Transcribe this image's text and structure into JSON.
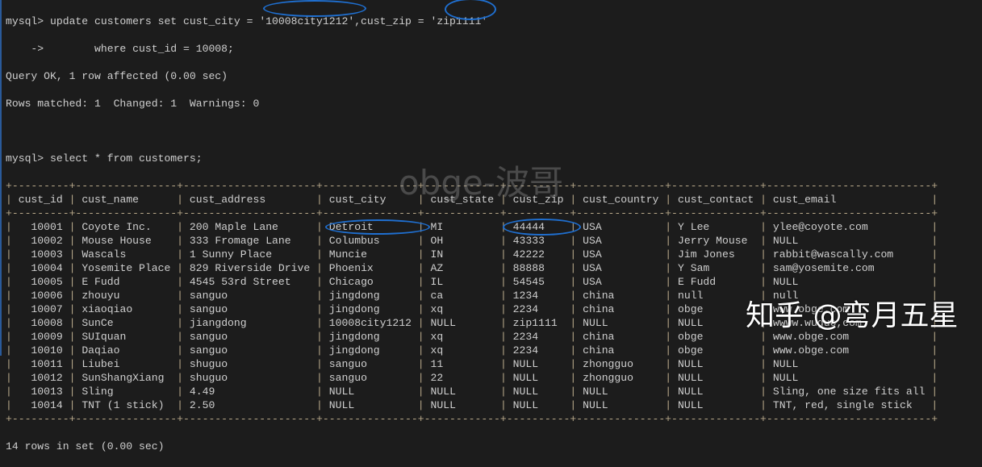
{
  "command": {
    "line1_prefix": "mysql> update customers set cust_city = ",
    "city_value": "'10008city1212'",
    "mid": ",cust_zip = ",
    "zip_value": "'zip1111'",
    "line2": "    ->        where cust_id = 10008;",
    "result1": "Query OK, 1 row affected (0.00 sec)",
    "result2": "Rows matched: 1  Changed: 1  Warnings: 0",
    "select": "mysql> select * from customers;"
  },
  "table": {
    "columns": [
      "cust_id",
      "cust_name",
      "cust_address",
      "cust_city",
      "cust_state",
      "cust_zip",
      "cust_country",
      "cust_contact",
      "cust_email"
    ],
    "rows": [
      [
        "10001",
        "Coyote Inc.",
        "200 Maple Lane",
        "Detroit",
        "MI",
        "44444",
        "USA",
        "Y Lee",
        "ylee@coyote.com"
      ],
      [
        "10002",
        "Mouse House",
        "333 Fromage Lane",
        "Columbus",
        "OH",
        "43333",
        "USA",
        "Jerry Mouse",
        "NULL"
      ],
      [
        "10003",
        "Wascals",
        "1 Sunny Place",
        "Muncie",
        "IN",
        "42222",
        "USA",
        "Jim Jones",
        "rabbit@wascally.com"
      ],
      [
        "10004",
        "Yosemite Place",
        "829 Riverside Drive",
        "Phoenix",
        "AZ",
        "88888",
        "USA",
        "Y Sam",
        "sam@yosemite.com"
      ],
      [
        "10005",
        "E Fudd",
        "4545 53rd Street",
        "Chicago",
        "IL",
        "54545",
        "USA",
        "E Fudd",
        "NULL"
      ],
      [
        "10006",
        "zhouyu",
        "sanguo",
        "jingdong",
        "ca",
        "1234",
        "china",
        "null",
        "null"
      ],
      [
        "10007",
        "xiaoqiao",
        "sanguo",
        "jingdong",
        "xq",
        "2234",
        "china",
        "obge",
        "www.obge.com"
      ],
      [
        "10008",
        "SunCe",
        "jiangdong",
        "10008city1212",
        "NULL",
        "zip1111",
        "NULL",
        "NULL",
        "wwww.wuguo,com"
      ],
      [
        "10009",
        "SUIquan",
        "sanguo",
        "jingdong",
        "xq",
        "2234",
        "china",
        "obge",
        "www.obge.com"
      ],
      [
        "10010",
        "Daqiao",
        "sanguo",
        "jingdong",
        "xq",
        "2234",
        "china",
        "obge",
        "www.obge.com"
      ],
      [
        "10011",
        "Liubei",
        "shuguo",
        "sanguo",
        "11",
        "NULL",
        "zhongguo",
        "NULL",
        "NULL"
      ],
      [
        "10012",
        "SunShangXiang",
        "shuguo",
        "sanguo",
        "22",
        "NULL",
        "zhongguo",
        "NULL",
        "NULL"
      ],
      [
        "10013",
        "Sling",
        "4.49",
        "NULL",
        "NULL",
        "NULL",
        "NULL",
        "NULL",
        "Sling, one size fits all"
      ],
      [
        "10014",
        "TNT (1 stick)",
        "2.50",
        "NULL",
        "NULL",
        "NULL",
        "NULL",
        "NULL",
        "TNT, red, single stick"
      ]
    ]
  },
  "footer": "14 rows in set (0.00 sec)",
  "watermarks": {
    "blog": "obge-波哥",
    "zhihu": "知乎 @弯月五星"
  }
}
